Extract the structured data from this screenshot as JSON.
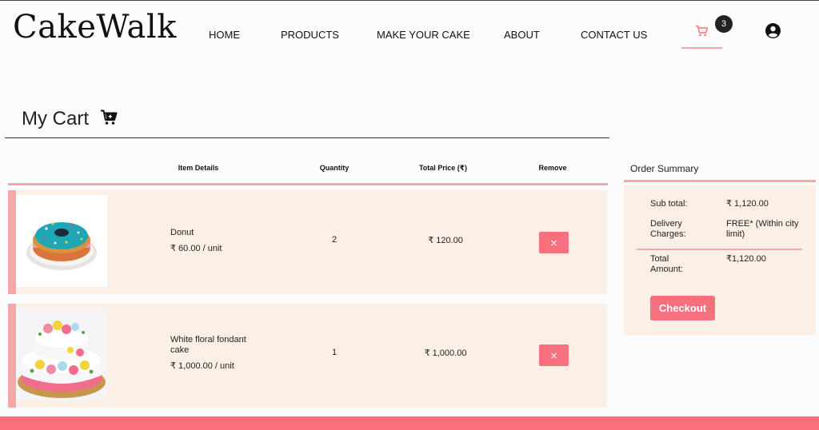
{
  "brand": {
    "logo": "CakeWalk"
  },
  "nav": {
    "items": [
      "HOME",
      "PRODUCTS",
      "MAKE YOUR CAKE",
      "ABOUT",
      "CONTACT US"
    ],
    "cart_count": "3"
  },
  "page": {
    "title": "My Cart"
  },
  "cart_table": {
    "headers": {
      "item": "Item Details",
      "quantity": "Quantity",
      "total": "Total Price (₹)",
      "remove": "Remove"
    },
    "rows": [
      {
        "name": "Donut",
        "unit_price": "₹ 60.00 / unit",
        "quantity": "2",
        "total": "₹ 120.00",
        "remove_label": "×"
      },
      {
        "name": "White floral fondant cake",
        "unit_price": "₹ 1,000.00 / unit",
        "quantity": "1",
        "total": "₹ 1,000.00",
        "remove_label": "×"
      }
    ]
  },
  "summary": {
    "title": "Order Summary",
    "subtotal_label": "Sub total:",
    "subtotal_value": "₹ 1,120.00",
    "delivery_label": "Delivery Charges:",
    "delivery_value": "FREE* (Within city limit)",
    "total_label": "Total Amount:",
    "total_value": "₹1,120.00",
    "checkout_label": "Checkout"
  },
  "colors": {
    "accent": "#f7707d",
    "accent_light": "#f6a6a9",
    "row_bg": "#fbefe6",
    "footer": "#fb6f7d"
  }
}
